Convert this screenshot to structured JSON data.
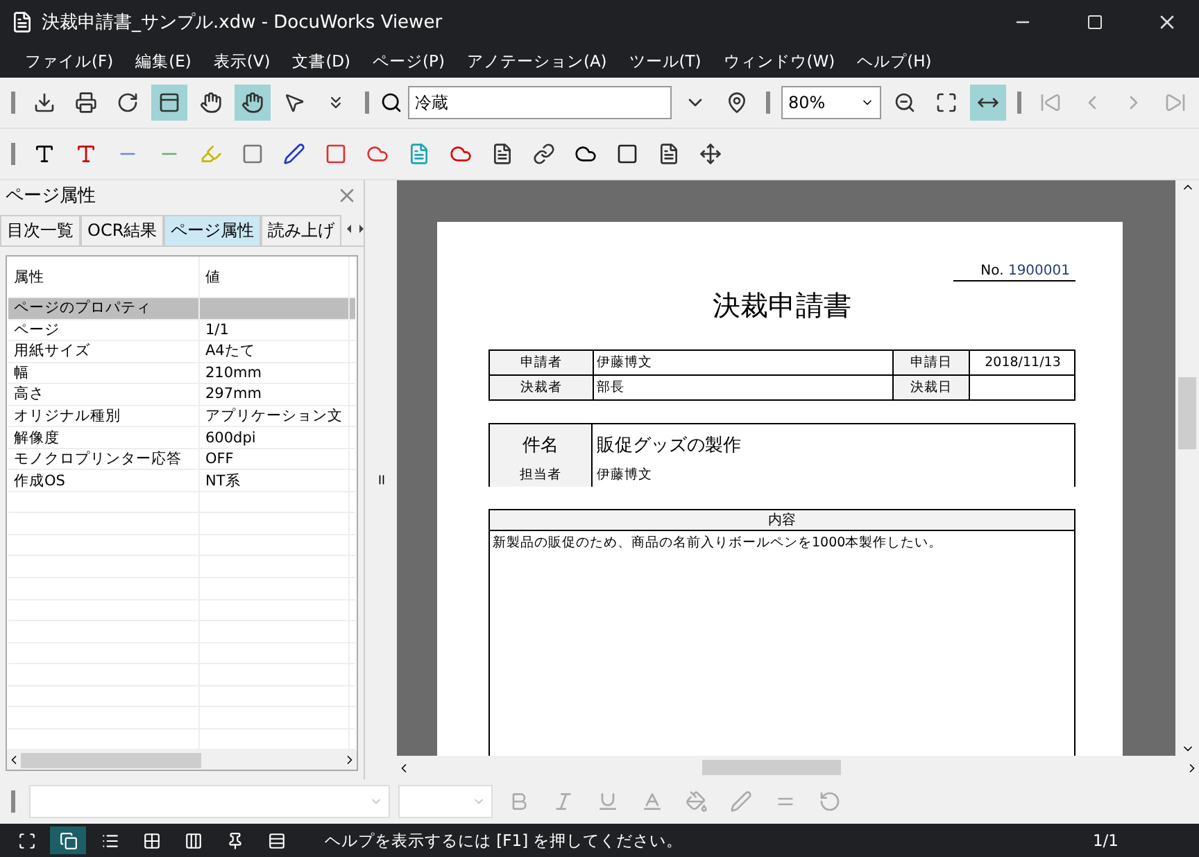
{
  "window": {
    "title": "決裁申請書_サンプル.xdw - DocuWorks Viewer"
  },
  "menu": [
    "ファイル(F)",
    "編集(E)",
    "表示(V)",
    "文書(D)",
    "ページ(P)",
    "アノテーション(A)",
    "ツール(T)",
    "ウィンドウ(W)",
    "ヘルプ(H)"
  ],
  "toolbar": {
    "buttons": [
      {
        "selected": false
      },
      {
        "selected": false
      },
      {
        "selected": false
      },
      {
        "selected": true
      },
      {
        "selected": false
      },
      {
        "selected": true
      },
      {
        "selected": false
      }
    ],
    "search": {
      "value": "冷蔵"
    },
    "zoom": {
      "value": "80%"
    },
    "fit_buttons": [
      {
        "selected": false
      },
      {
        "selected": false
      },
      {
        "selected": true
      }
    ],
    "page_nav": [
      {
        "disabled": true
      },
      {
        "disabled": true
      },
      {
        "disabled": true
      },
      {
        "disabled": true
      }
    ]
  },
  "panel": {
    "title": "ページ属性",
    "tabs": [
      {
        "label": "目次一覧",
        "selected": false
      },
      {
        "label": "OCR結果",
        "selected": false
      },
      {
        "label": "ページ属性",
        "selected": true
      },
      {
        "label": "読み上げ",
        "selected": false
      }
    ],
    "columns": [
      "属性",
      "値"
    ],
    "rows": [
      {
        "kind": "group",
        "name": "ページのプロパティ"
      },
      {
        "kind": "item",
        "name": "ページ",
        "value": "1/1"
      },
      {
        "kind": "item",
        "name": "用紙サイズ",
        "value": "A4たて"
      },
      {
        "kind": "item",
        "name": "幅",
        "value": "210mm"
      },
      {
        "kind": "item",
        "name": "高さ",
        "value": "297mm"
      },
      {
        "kind": "item",
        "name": "オリジナル種別",
        "value": "アプリケーション文"
      },
      {
        "kind": "item",
        "name": "解像度",
        "value": "600dpi"
      },
      {
        "kind": "item",
        "name": "モノクロプリンター応答",
        "value": "OFF"
      },
      {
        "kind": "item",
        "name": "作成OS",
        "value": "NT系"
      }
    ]
  },
  "document": {
    "number_label": "No.",
    "number": "1900001",
    "title": "決裁申請書",
    "info": [
      {
        "label": "申請者",
        "value": "伊藤博文",
        "date_label": "申請日",
        "date": "2018/11/13"
      },
      {
        "label": "決裁者",
        "value": "部長",
        "date_label": "決裁日"
      }
    ],
    "subject_label": "件名",
    "subject": "販促グッズの製作",
    "owner_label": "担当者",
    "owner": "伊藤博文",
    "content_label": "内容",
    "content": "新製品の販促のため、商品の名前入りボールペンを1000本製作したい。"
  },
  "status_bar": {
    "views": [
      {
        "selected": false
      },
      {
        "selected": true
      },
      {
        "selected": false
      },
      {
        "selected": false
      },
      {
        "selected": false
      },
      {
        "selected": false
      },
      {
        "selected": false
      }
    ],
    "message": "ヘルプを表示するには [F1] を押してください。",
    "page": "1/1"
  }
}
